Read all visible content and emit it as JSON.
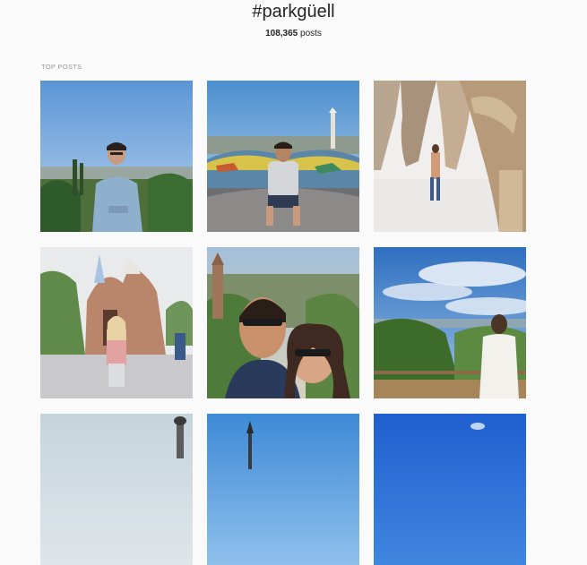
{
  "header": {
    "hashtag": "#parkgüell",
    "post_count": "108,365",
    "post_count_suffix": " posts"
  },
  "sections": {
    "top_posts_label": "TOP POSTS"
  },
  "posts": [
    {
      "scene": "man-in-denim-shirt-overlooking-city"
    },
    {
      "scene": "man-sitting-on-mosaic-bench"
    },
    {
      "scene": "woman-in-stone-colonnade"
    },
    {
      "scene": "woman-in-front-of-gingerbread-house"
    },
    {
      "scene": "couple-selfie-with-sunglasses"
    },
    {
      "scene": "woman-overlooking-city-from-terrace"
    },
    {
      "scene": "lamp-post-against-sky"
    },
    {
      "scene": "spire-against-blue-sky"
    },
    {
      "scene": "deep-blue-sky"
    }
  ]
}
